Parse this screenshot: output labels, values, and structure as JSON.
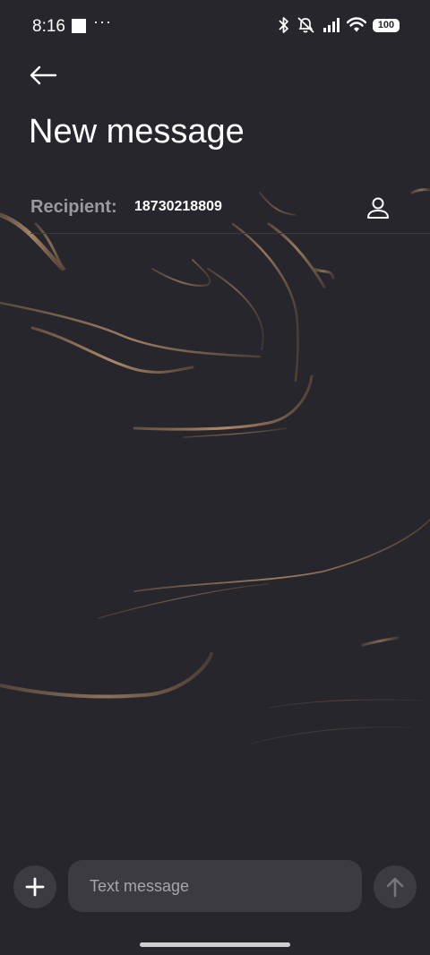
{
  "status_bar": {
    "time": "8:16",
    "overflow": "···",
    "battery": "100",
    "icons": [
      "bluetooth-icon",
      "mute-icon",
      "signal-icon",
      "wifi-icon",
      "battery-icon"
    ]
  },
  "header": {
    "back_icon": "arrow-left-icon",
    "title": "New message"
  },
  "recipient": {
    "label": "Recipient:",
    "value": "18730218809",
    "contact_icon": "person-icon"
  },
  "composer": {
    "add_icon": "plus-icon",
    "placeholder": "Text message",
    "value": "",
    "send_icon": "arrow-up-icon"
  },
  "colors": {
    "background": "#27262c",
    "surface": "#3c3b41",
    "accent_swirl": "#b08868",
    "muted_text": "#9a999e"
  }
}
